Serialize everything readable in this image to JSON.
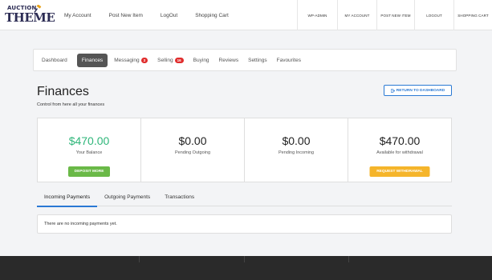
{
  "header": {
    "logo_top": "AUCTION",
    "logo_main": "THEME",
    "nav_left": [
      "My Account",
      "Post New Item",
      "LogOut",
      "Shopping Cart"
    ],
    "nav_right": [
      "WP-ADMIN",
      "MY ACCOUNT",
      "POST NEW ITEM",
      "LOGOUT",
      "SHOPPING CART"
    ]
  },
  "tabs": [
    {
      "label": "Dashboard"
    },
    {
      "label": "Finances",
      "active": true
    },
    {
      "label": "Messaging",
      "badge": "3"
    },
    {
      "label": "Selling",
      "badge": "16"
    },
    {
      "label": "Buying"
    },
    {
      "label": "Reviews"
    },
    {
      "label": "Settings"
    },
    {
      "label": "Favourites"
    }
  ],
  "page": {
    "title": "Finances",
    "subtitle": "Control from here all your finances",
    "return_label": "RETURN TO DASHBOARD"
  },
  "cards": [
    {
      "amount": "$470.00",
      "label": "Your Balance",
      "button": "DEPOSIT MORE"
    },
    {
      "amount": "$0.00",
      "label": "Pending Outgoing"
    },
    {
      "amount": "$0.00",
      "label": "Pending Incoming"
    },
    {
      "amount": "$470.00",
      "label": "Available for withdrawal",
      "button": "REQUEST WITHDRAWAL"
    }
  ],
  "payment_tabs": [
    "Incoming Payments",
    "Outgoing Payments",
    "Transactions"
  ],
  "empty_message": "There are no incoming payments yet.",
  "colors": {
    "accent_blue": "#2a79d4",
    "green_amount": "#2fb67a",
    "deposit_button": "#6ab947",
    "withdraw_button": "#f5b52b",
    "badge_red": "#e02d2d",
    "footer": "#2a2a2a"
  }
}
